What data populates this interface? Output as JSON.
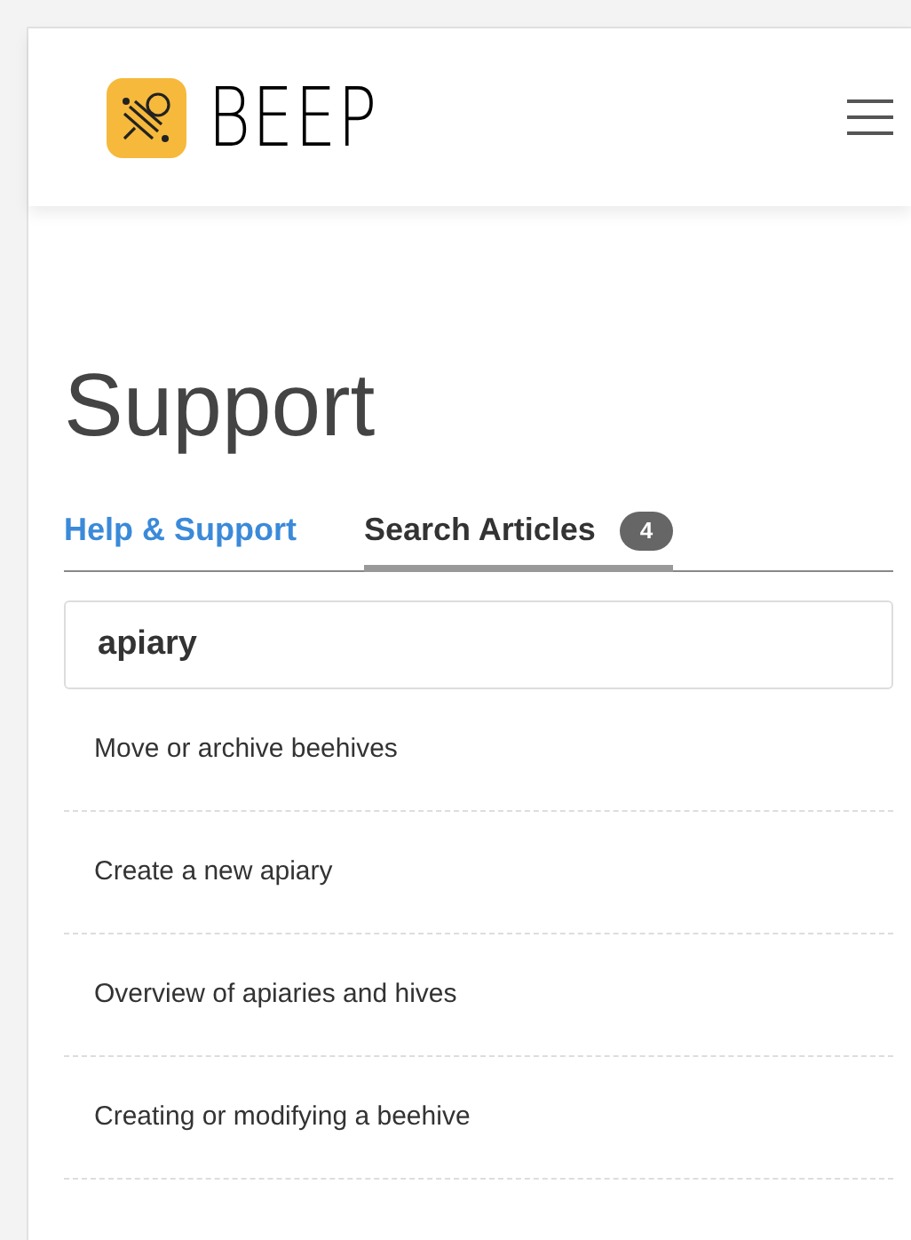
{
  "header": {
    "brand": "BEEP"
  },
  "title": "Support",
  "tabs": [
    {
      "label": "Help & Support",
      "selected": false
    },
    {
      "label": "Search Articles",
      "selected": true,
      "count": "4"
    }
  ],
  "search": {
    "value": "apiary"
  },
  "articles": [
    "Move or archive beehives",
    "Create a new apiary",
    "Overview of apiaries and hives",
    "Creating or modifying a beehive"
  ]
}
